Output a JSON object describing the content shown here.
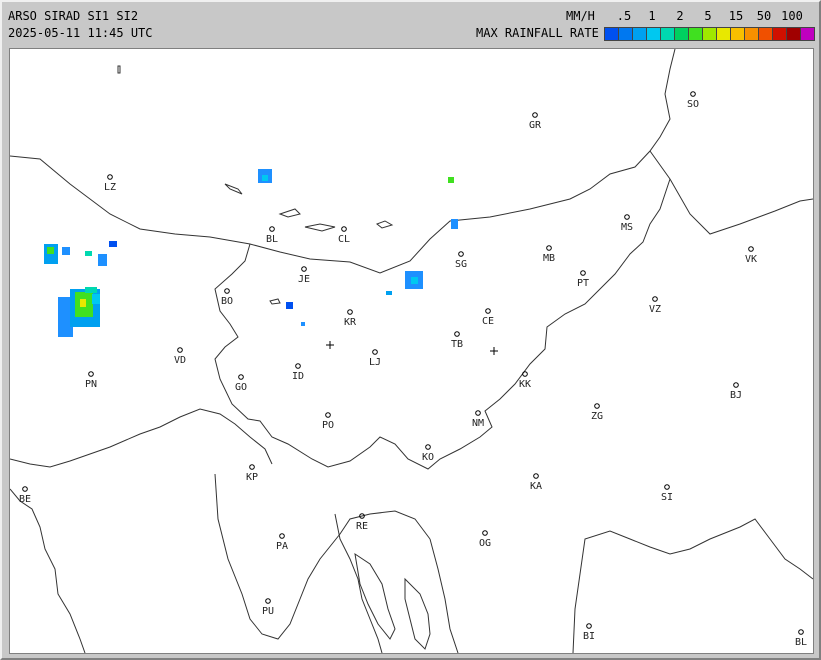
{
  "header": {
    "title": "ARSO SIRAD SI1 SI2",
    "timestamp": "2025-05-11 11:45 UTC",
    "unit": "MM/H",
    "legend_title": "MAX RAINFALL RATE"
  },
  "legend": {
    "ticks": [
      ".5",
      "1",
      "2",
      "5",
      "15",
      "50",
      "100"
    ],
    "colors": [
      "#0050f0",
      "#0078f0",
      "#00a0f0",
      "#00c8f0",
      "#00d8b0",
      "#00d060",
      "#40e020",
      "#a0e800",
      "#e8e800",
      "#f8c000",
      "#f89000",
      "#f05000",
      "#d01000",
      "#a00000",
      "#c000c0"
    ]
  },
  "cities": [
    {
      "code": "SO"
    },
    {
      "code": "GR"
    },
    {
      "code": "LZ"
    },
    {
      "code": "BL"
    },
    {
      "code": "CL"
    },
    {
      "code": "MS"
    },
    {
      "code": "MB"
    },
    {
      "code": "VK"
    },
    {
      "code": "JE"
    },
    {
      "code": "SG"
    },
    {
      "code": "PT"
    },
    {
      "code": "BO"
    },
    {
      "code": "KR"
    },
    {
      "code": "CE"
    },
    {
      "code": "VZ"
    },
    {
      "code": "TB"
    },
    {
      "code": "VD"
    },
    {
      "code": "LJ"
    },
    {
      "code": "PN"
    },
    {
      "code": "GO"
    },
    {
      "code": "ID"
    },
    {
      "code": "KK"
    },
    {
      "code": "BJ"
    },
    {
      "code": "ZG"
    },
    {
      "code": "NM"
    },
    {
      "code": "PO"
    },
    {
      "code": "KO"
    },
    {
      "code": "KP"
    },
    {
      "code": "KA"
    },
    {
      "code": "BE"
    },
    {
      "code": "SI"
    },
    {
      "code": "RE"
    },
    {
      "code": "PA"
    },
    {
      "code": "OG"
    },
    {
      "code": "PU"
    },
    {
      "code": "BI"
    },
    {
      "code": "BL"
    }
  ]
}
